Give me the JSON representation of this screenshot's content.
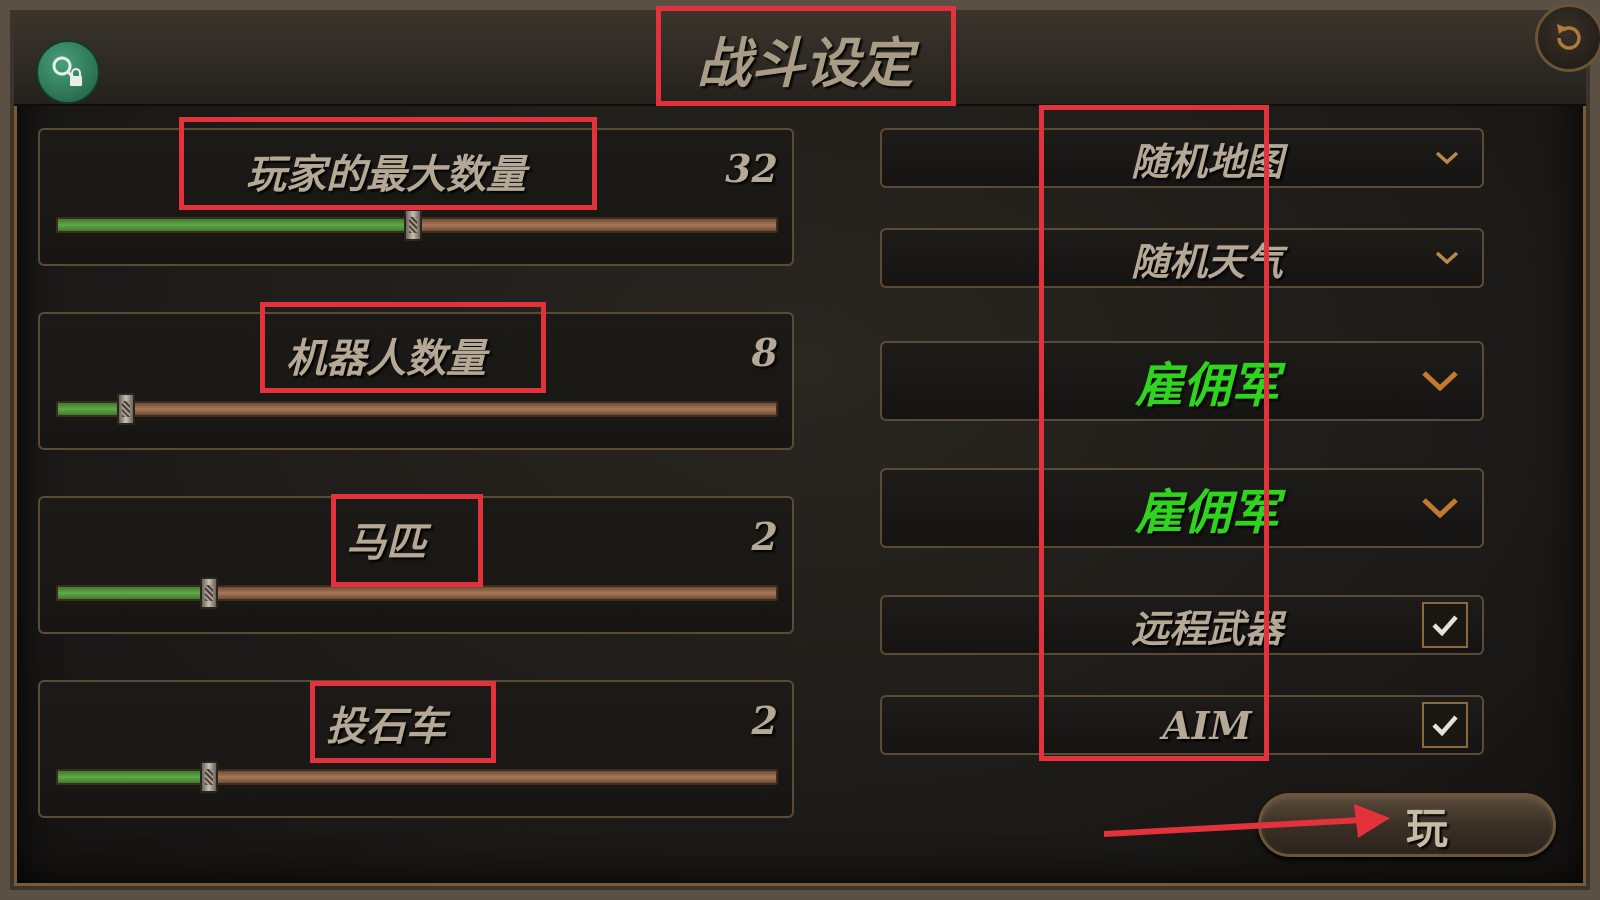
{
  "header": {
    "title": "战斗设定"
  },
  "sliders": [
    {
      "label": "玩家的最大数量",
      "value": "32",
      "fill_fraction": 0.495
    },
    {
      "label": "机器人数量",
      "value": "8",
      "fill_fraction": 0.095
    },
    {
      "label": "马匹",
      "value": "2",
      "fill_fraction": 0.21
    },
    {
      "label": "投石车",
      "value": "2",
      "fill_fraction": 0.21
    }
  ],
  "options": {
    "map": "随机地图",
    "weather": "随机天气",
    "faction1": "雇佣军",
    "faction2": "雇佣军",
    "ranged": {
      "label": "远程武器",
      "checked": true
    },
    "aim": {
      "label": "AIM",
      "checked": true
    }
  },
  "play_button": {
    "label": "玩"
  },
  "colors": {
    "accent_green": "#2fd41f",
    "annotation_red": "#e4323c",
    "slider_fill": "#5fa848",
    "text": "#b5a996"
  },
  "icons": [
    "key-lock-icon",
    "reset-icon",
    "chevron-down-icon",
    "checkmark-icon"
  ]
}
